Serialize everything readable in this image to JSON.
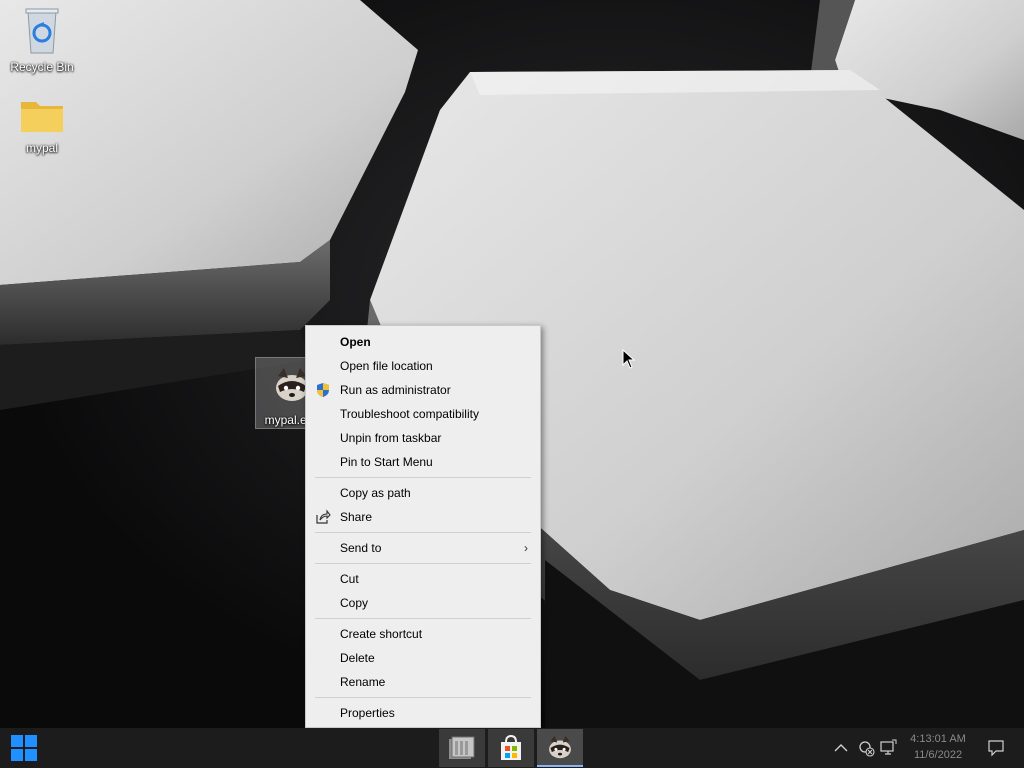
{
  "desktop": {
    "icons": [
      {
        "label": "Recycle Bin",
        "icon": "recycle-bin-icon"
      },
      {
        "label": "mypal",
        "icon": "folder-icon"
      },
      {
        "label": "mypal.exe",
        "icon": "mypal-app-icon"
      }
    ]
  },
  "context_menu": {
    "items": [
      {
        "label": "Open",
        "bold": true
      },
      {
        "label": "Open file location"
      },
      {
        "label": "Run as administrator",
        "icon": "uac-shield-icon"
      },
      {
        "label": "Troubleshoot compatibility"
      },
      {
        "label": "Unpin from taskbar"
      },
      {
        "label": "Pin to Start Menu"
      },
      {
        "label": "Copy as path"
      },
      {
        "label": "Share",
        "icon": "share-icon"
      },
      {
        "label": "Send to",
        "submenu": true
      },
      {
        "label": "Cut"
      },
      {
        "label": "Copy"
      },
      {
        "label": "Create shortcut"
      },
      {
        "label": "Delete"
      },
      {
        "label": "Rename"
      },
      {
        "label": "Properties"
      }
    ],
    "submenu_arrow": "›"
  },
  "taskbar": {
    "start_icon": "windows-logo-icon",
    "pinned": [
      {
        "name": "file-explorer",
        "icon": "file-explorer-icon"
      },
      {
        "name": "store",
        "icon": "store-icon"
      },
      {
        "name": "mypal",
        "icon": "mypal-app-icon",
        "active": true
      }
    ],
    "tray": {
      "chevron": "^",
      "time": "4:13:01 AM",
      "date": "11/6/2022"
    }
  },
  "colors": {
    "taskbar_bg": "#1c1c1c",
    "menu_bg": "#eeeeee",
    "windows_blue": "#1e90ff",
    "folder_yellow": "#f2c94c"
  }
}
